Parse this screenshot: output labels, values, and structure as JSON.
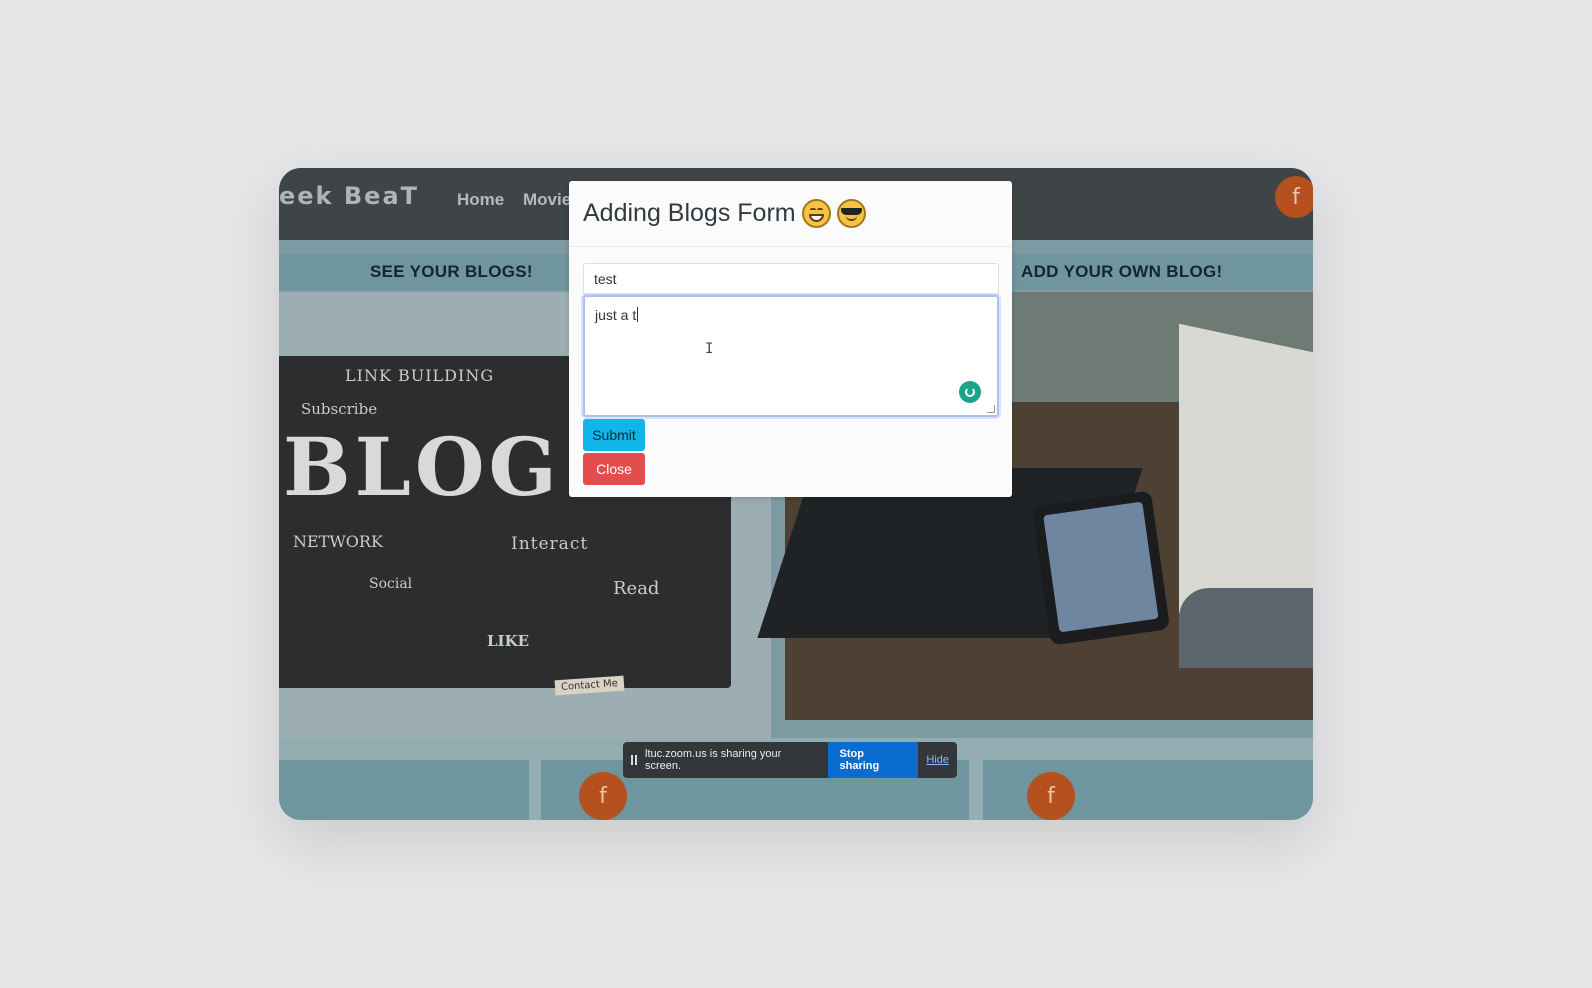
{
  "navbar": {
    "logo_text": "eek BeaT",
    "links": [
      "Home",
      "Movie"
    ],
    "facebook_glyph": "f"
  },
  "sections": {
    "left_title": "SEE YOUR BLOGS!",
    "right_title": "ADD YOUR OWN BLOG!"
  },
  "blog_image_words": {
    "link_building": "LINK BUILDING",
    "subscribe": "Subscribe",
    "blog": "BLOG",
    "network": "NETWORK",
    "interact": "Interact",
    "social": "Social",
    "read": "Read",
    "like": "LIKE",
    "contact": "Contact Me"
  },
  "modal": {
    "title": "Adding Blogs Form",
    "title_input_value": "test",
    "body_textarea_value": "just a t",
    "submit_label": "Submit",
    "close_label": "Close",
    "emojis": [
      "grinning-face-icon",
      "smiling-face-with-sunglasses-icon"
    ]
  },
  "share_bar": {
    "message": "ltuc.zoom.us is sharing your screen.",
    "stop_label": "Stop sharing",
    "hide_label": "Hide"
  },
  "colors": {
    "navbar": "#3f4447",
    "facebook": "#b5501f",
    "submit": "#11b5ea",
    "close": "#e24d4d",
    "stop_sharing": "#0b6ccf",
    "grammar_icon": "#16a58a"
  }
}
